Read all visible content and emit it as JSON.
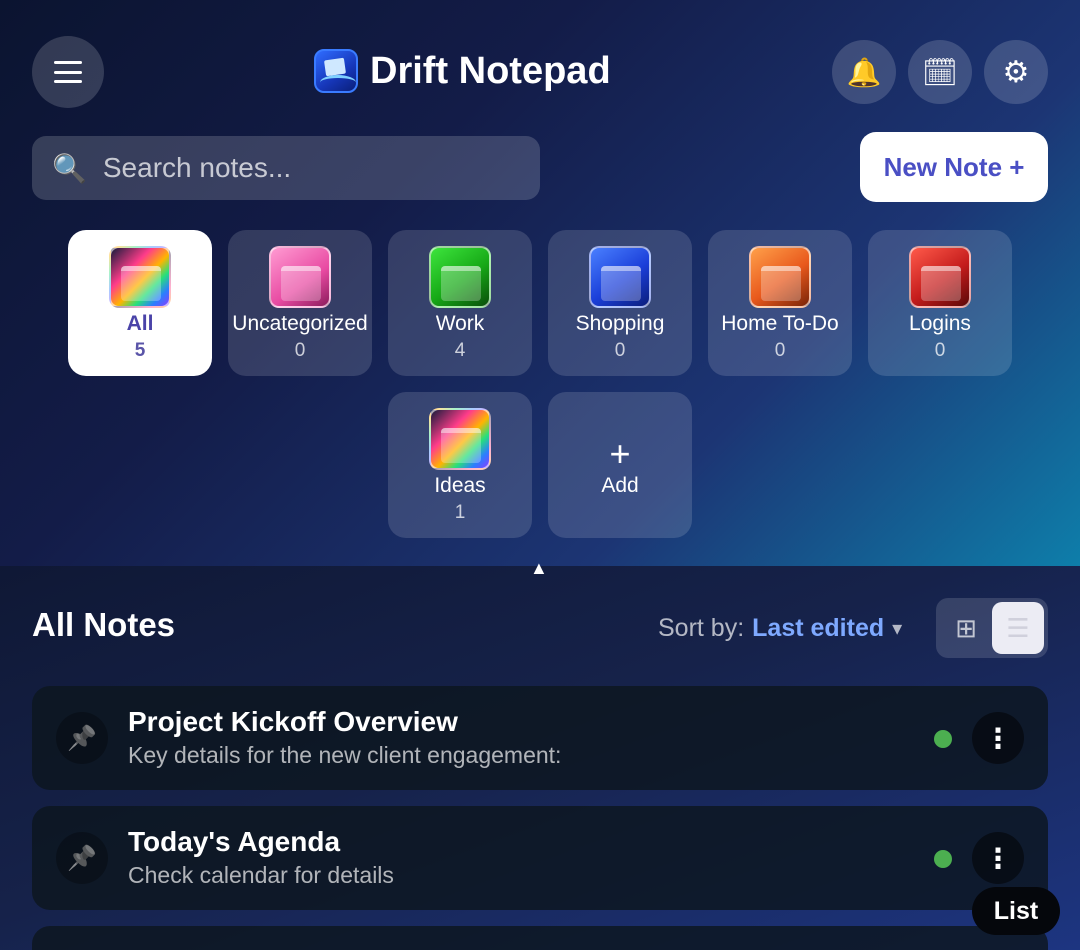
{
  "app": {
    "title": "Drift Notepad"
  },
  "header": {
    "menu_icon": "hamburger-menu-icon",
    "actions": [
      {
        "icon": "bell-icon",
        "glyph": "🔔"
      },
      {
        "icon": "calendar-icon",
        "glyph": "🗓"
      },
      {
        "icon": "gear-icon",
        "glyph": "⚙"
      }
    ]
  },
  "search": {
    "placeholder": "Search notes...",
    "value": "",
    "icon": "search-icon",
    "glyph": "🔍"
  },
  "new_note": {
    "label": "New Note +"
  },
  "categories": [
    {
      "name": "All",
      "count": "5",
      "active": true,
      "icon": "rainbow-folder-icon"
    },
    {
      "name": "Uncategorized",
      "count": "0",
      "active": false,
      "icon": "pink-folder-icon"
    },
    {
      "name": "Work",
      "count": "4",
      "active": false,
      "icon": "green-folder-icon"
    },
    {
      "name": "Shopping",
      "count": "0",
      "active": false,
      "icon": "blue-folder-icon"
    },
    {
      "name": "Home To-Do",
      "count": "0",
      "active": false,
      "icon": "orange-folder-icon"
    },
    {
      "name": "Logins",
      "count": "0",
      "active": false,
      "icon": "red-folder-icon"
    },
    {
      "name": "Ideas",
      "count": "1",
      "active": false,
      "icon": "rainbow-folder-icon"
    }
  ],
  "add_category": {
    "plus": "+",
    "label": "Add"
  },
  "collapse": {
    "glyph": "▲"
  },
  "notes_section": {
    "title": "All Notes",
    "sort_label": "Sort by:",
    "sort_value": "Last edited",
    "sort_caret": "▾",
    "view_grid_glyph": "⊞",
    "view_list_glyph": "☰",
    "active_view": "list"
  },
  "notes": [
    {
      "title": "Project Kickoff Overview",
      "preview": "Key details for the new client engagement:",
      "pin_glyph": "📌",
      "more_glyph": "⋮",
      "status_color": "#4caf50"
    },
    {
      "title": "Today's Agenda",
      "preview": "Check calendar for details",
      "pin_glyph": "📌",
      "more_glyph": "⋮",
      "status_color": "#4caf50"
    }
  ],
  "tooltip": {
    "text": "List"
  },
  "colors": {
    "accent": "#4a4fc4",
    "sort_accent": "#7ea9ff",
    "status_green": "#4caf50"
  }
}
